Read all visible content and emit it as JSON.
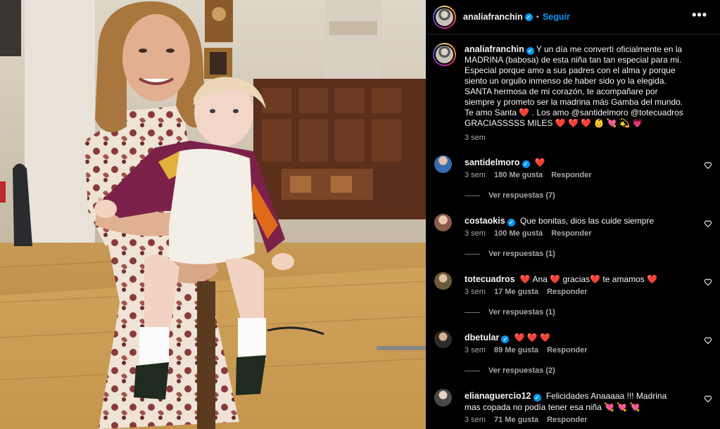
{
  "post": {
    "username": "analiafranchin",
    "verified": true,
    "follow_label": "Seguir",
    "more_label": "•••",
    "caption": "Y un día me convertí oficialmente en la MADRINA (babosa) de esta niña tan tan especial para mi. Especial porque amo a sus padres con el alma y porque siento un orgullo inmenso de haber sido yo la elegida. SANTA hermosa de mi corazón, te acompañare por siempre y prometo ser la madrina más Gamba del mundo. Te amo Santa ❤️ . Los amo @santidelmoro @totecuadros GRACIASSSSS MILES ❤️ ❤️ ❤️ 👶 💘 💫 💗",
    "time": "3 sem"
  },
  "comments": [
    {
      "username": "santidelmoro",
      "verified": true,
      "text": "❤️",
      "time": "3 sem",
      "likes": "180 Me gusta",
      "reply_label": "Responder",
      "replies": "Ver respuestas (7)"
    },
    {
      "username": "costaokis",
      "verified": true,
      "text": "Que bonitas, dios las cuide siempre",
      "time": "3 sem",
      "likes": "100 Me gusta",
      "reply_label": "Responder",
      "replies": "Ver respuestas (1)"
    },
    {
      "username": "totecuadros",
      "verified": false,
      "text": "❤️ Ana ❤️ gracias❤️ te amamos ❤️",
      "time": "3 sem",
      "likes": "17 Me gusta",
      "reply_label": "Responder",
      "replies": "Ver respuestas (1)"
    },
    {
      "username": "dbetular",
      "verified": true,
      "text": "❤️ ❤️ ❤️",
      "time": "3 sem",
      "likes": "89 Me gusta",
      "reply_label": "Responder",
      "replies": "Ver respuestas (2)"
    },
    {
      "username": "elianaguercio12",
      "verified": true,
      "text": "Felicidades Anaaaaa !!! Madrina mas copada no podía tener esa niña 💘 💘 💘",
      "time": "3 sem",
      "likes": "71 Me gusta",
      "reply_label": "Responder",
      "replies": ""
    }
  ],
  "colors": {
    "accent": "#0095f6",
    "background": "#000000",
    "secondary_text": "#a8a8a8",
    "heart": "#ff3040"
  }
}
